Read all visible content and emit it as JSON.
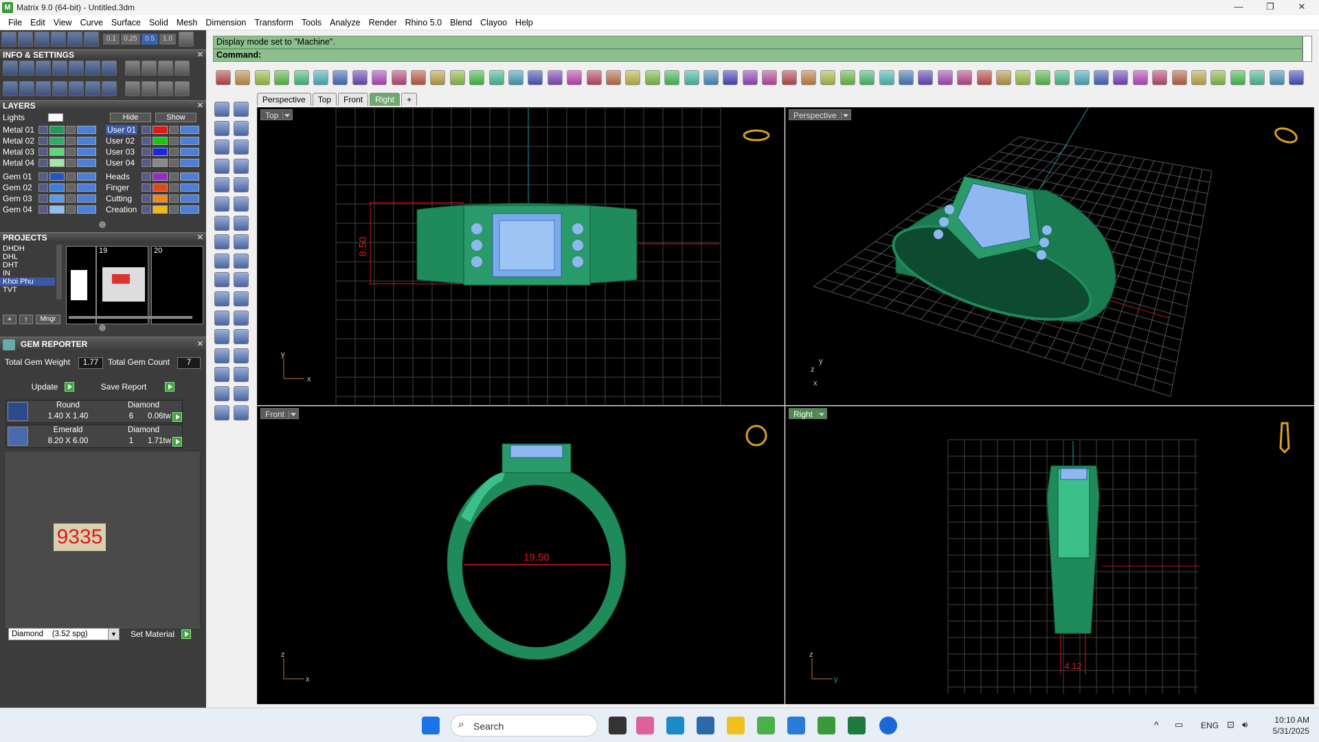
{
  "window": {
    "title": "Matrix 9.0 (64-bit) - Untitled.3dm",
    "controls": [
      "—",
      "❐",
      "✕"
    ]
  },
  "menu": [
    "File",
    "Edit",
    "View",
    "Curve",
    "Surface",
    "Solid",
    "Mesh",
    "Dimension",
    "Transform",
    "Tools",
    "Analyze",
    "Render",
    "Rhino 5.0",
    "Blend",
    "Clayoo",
    "Help"
  ],
  "top_toolbar": {
    "values": [
      "0.1",
      "0.25",
      "0.5",
      "1.0"
    ]
  },
  "info_settings": {
    "title": "INFO & SETTINGS"
  },
  "layers": {
    "title": "LAYERS",
    "lights_label": "Lights",
    "hide_label": "Hide",
    "show_label": "Show",
    "left": [
      {
        "name": "Metal 01",
        "color": "#1f9a57"
      },
      {
        "name": "Metal 02",
        "color": "#29b060"
      },
      {
        "name": "Metal 03",
        "color": "#5ed67a"
      },
      {
        "name": "Metal 04",
        "color": "#a3e8a8"
      },
      {
        "name": "Gem 01",
        "color": "#2056c8"
      },
      {
        "name": "Gem 02",
        "color": "#3b7ee0"
      },
      {
        "name": "Gem 03",
        "color": "#5a9af0"
      },
      {
        "name": "Gem 04",
        "color": "#8fbdf5"
      }
    ],
    "right": [
      {
        "name": "User 01",
        "color": "#e01818",
        "selected": true
      },
      {
        "name": "User 02",
        "color": "#18c818"
      },
      {
        "name": "User 03",
        "color": "#1828e0"
      },
      {
        "name": "User 04",
        "color": "#888888"
      },
      {
        "name": "Heads",
        "color": "#9a28c8"
      },
      {
        "name": "Finger",
        "color": "#e04818"
      },
      {
        "name": "Cutting",
        "color": "#f08818"
      },
      {
        "name": "Creation",
        "color": "#f0b818"
      }
    ]
  },
  "projects": {
    "title": "PROJECTS",
    "items": [
      "DHDH",
      "DHL",
      "DHT",
      "IN",
      "Khoi Phu",
      "TVT"
    ],
    "selected": "Khoi Phu",
    "thumb_numbers": [
      "19",
      "20"
    ],
    "mngr_label": "Mngr"
  },
  "gem_reporter": {
    "title": "GEM REPORTER",
    "total_weight_label": "Total Gem Weight",
    "total_weight": "1.77",
    "total_count_label": "Total Gem Count",
    "total_count": "7",
    "update_label": "Update",
    "save_label": "Save Report",
    "gems": [
      {
        "shape": "Round",
        "material": "Diamond",
        "size": "1.40 X 1.40",
        "qty": "6",
        "weight": "0.06tw"
      },
      {
        "shape": "Emerald",
        "material": "Diamond",
        "size": "8.20 X 6.00",
        "qty": "1",
        "weight": "1.71tw"
      }
    ],
    "code": "9335",
    "material_select": "Diamond    (3.52 spg)",
    "set_material_label": "Set Material"
  },
  "status": {
    "message": "Display mode set to \"Machine\".",
    "command_label": "Command:"
  },
  "viewport_tabs": [
    "Perspective",
    "Top",
    "Front",
    "Right"
  ],
  "active_tab": "Right",
  "viewports": {
    "top": {
      "label": "Top",
      "dimension": "8.50",
      "axis_x": "x",
      "axis_y": "y"
    },
    "perspective": {
      "label": "Perspective",
      "axis_x": "x",
      "axis_y": "y",
      "axis_z": "z"
    },
    "front": {
      "label": "Front",
      "dimension": "19.50",
      "axis_x": "x",
      "axis_z": "z"
    },
    "right": {
      "label": "Right",
      "dimension": "4.12",
      "axis_y": "y",
      "axis_z": "z"
    }
  },
  "colors": {
    "metal": "#1f8a5a",
    "gem": "#8fb8f0",
    "grid": "#555555",
    "dimension": "#e01818",
    "axis": "#1aa0a0"
  },
  "taskbar": {
    "search_placeholder": "Search",
    "language": "ENG",
    "time": "10:10 AM",
    "date": "5/31/2025"
  }
}
